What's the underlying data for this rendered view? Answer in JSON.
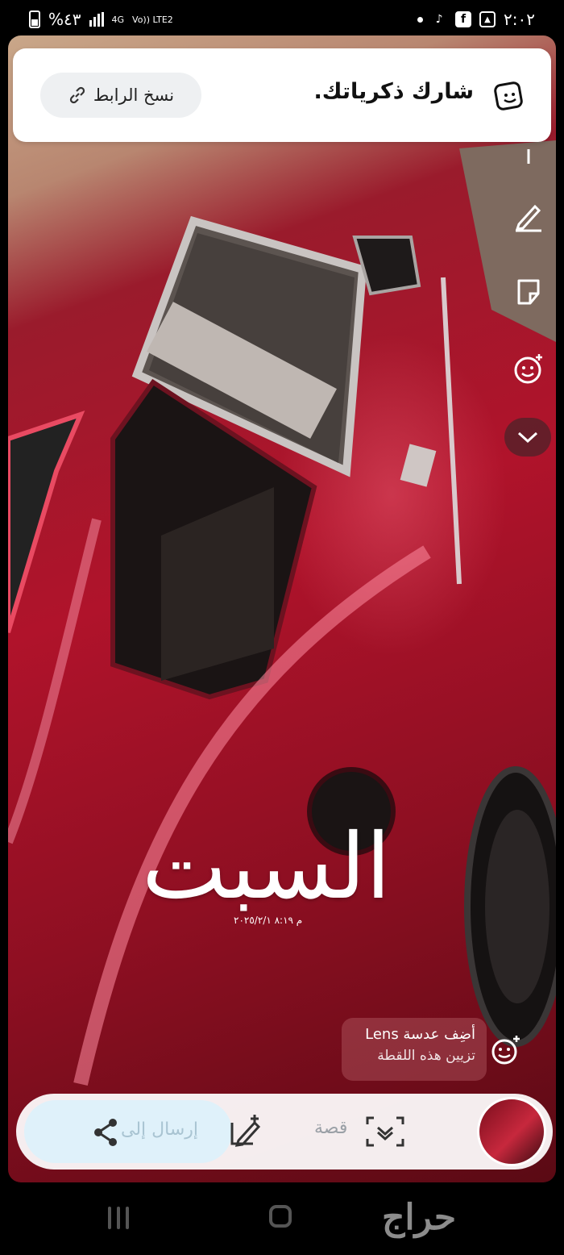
{
  "status_bar": {
    "time": "٢:٠٢",
    "battery_percent": "%٤٣",
    "network": "4G",
    "volte": "Vo)) LTE2",
    "icons": [
      "dot-icon",
      "tiktok-icon",
      "facebook-icon",
      "gallery-icon"
    ]
  },
  "share_card": {
    "title": "شارك ذكرياتك.",
    "copy_link_label": "نسخ الرابط",
    "icon": "memories-icon"
  },
  "overlay": {
    "day_text": "السبت",
    "date_text": "م ٨:١٩ ٢٠٢٥/٢/١"
  },
  "lens_chip": {
    "title": "أضِف عدسة Lens",
    "subtitle": "تزيين هذه اللقطة"
  },
  "action_bar": {
    "send_label": "إرسال إلى",
    "story_label": "قصة"
  },
  "nav_bar": {
    "watermark": "حراج"
  },
  "tools": [
    "text-icon",
    "pencil-icon",
    "sticker-icon",
    "emoji-icon",
    "chevron-down-icon"
  ]
}
